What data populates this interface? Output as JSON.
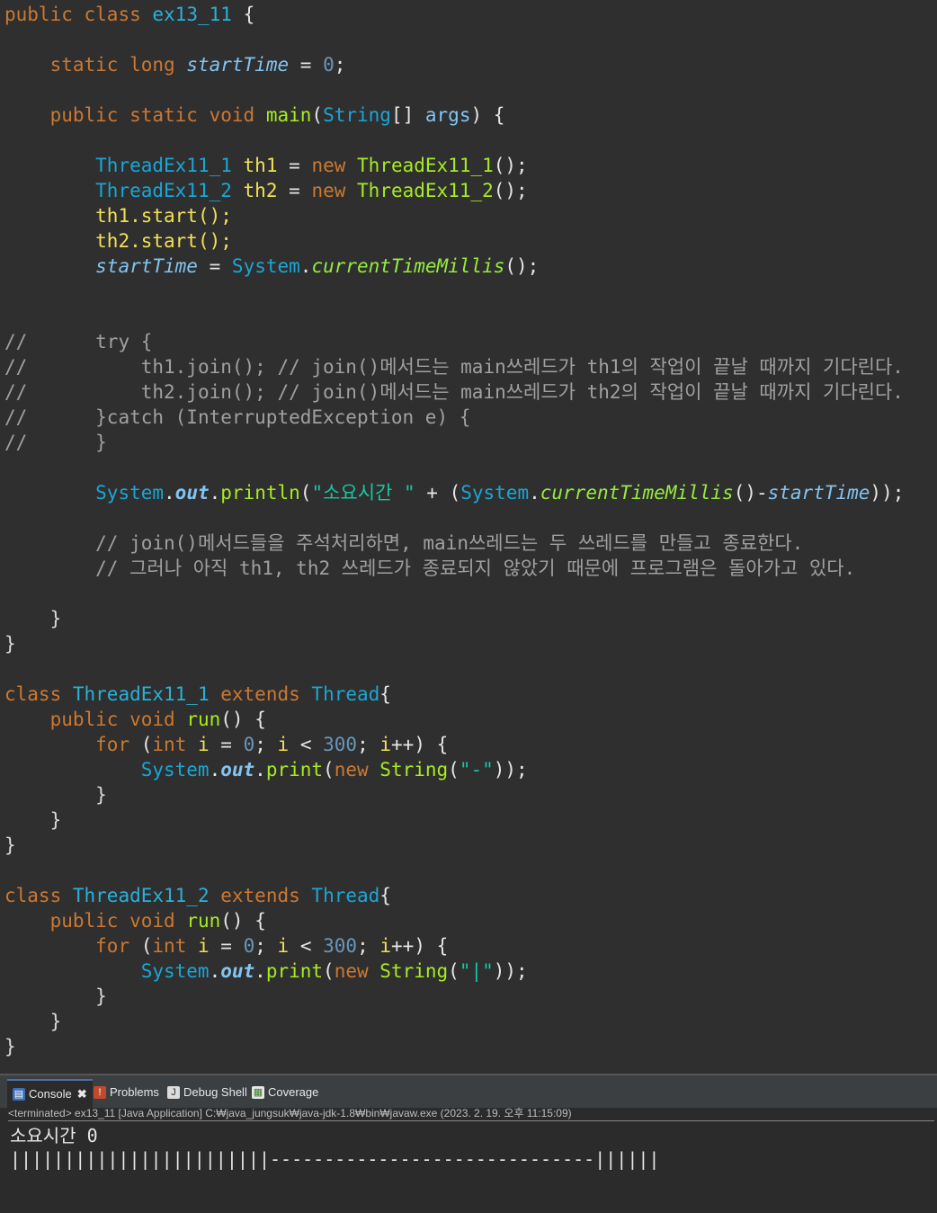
{
  "editor": {
    "class_decl": {
      "kw1": "public",
      "kw2": "class",
      "name": "ex13_11",
      "brace": "{"
    },
    "field": {
      "kw1": "static",
      "kw2": "long",
      "name": "startTime",
      "eq": "=",
      "val": "0",
      "end": ";"
    },
    "main_decl": {
      "kw1": "public",
      "kw2": "static",
      "kw3": "void",
      "name": "main",
      "p1": "(",
      "type": "String",
      "arr": "[]",
      "arg": "args",
      "p2": ") {"
    },
    "th1_decl": {
      "type": "ThreadEx11_1",
      "var": "th1",
      "eq": "=",
      "kw": "new",
      "ctor": "ThreadEx11_1",
      "end": "();"
    },
    "th2_decl": {
      "type": "ThreadEx11_2",
      "var": "th2",
      "eq": "=",
      "kw": "new",
      "ctor": "ThreadEx11_2",
      "end": "();"
    },
    "th1_start": "th1.start();",
    "th2_start": "th2.start();",
    "assign": {
      "var": "startTime",
      "eq": "=",
      "sys": "System",
      "dot": ".",
      "fn": "currentTimeMillis",
      "end": "();"
    },
    "commented": [
      {
        "slashes": "//",
        "code": "      try {"
      },
      {
        "slashes": "//",
        "code": "          th1.join(); // join()메서드는 main쓰레드가 th1의 작업이 끝날 때까지 기다린다."
      },
      {
        "slashes": "//",
        "code": "          th2.join(); // join()메서드는 main쓰레드가 th2의 작업이 끝날 때까지 기다린다."
      },
      {
        "slashes": "//",
        "code": "      }catch (InterruptedException e) {"
      },
      {
        "slashes": "//",
        "code": "      }"
      }
    ],
    "println": {
      "sys": "System",
      "dot1": ".",
      "out": "out",
      "dot2": ".",
      "fn": "println",
      "p1": "(",
      "str": "\"소요시간 \"",
      "plus": " + (",
      "sys2": "System",
      "dot3": ".",
      "fn2": "currentTimeMillis",
      "mid": "()-",
      "var": "startTime",
      "end": "));"
    },
    "comment1": "// join()메서드들을 주석처리하면, main쓰레드는 두 쓰레드를 만들고 종료한다.",
    "comment2": "// 그러나 아직 th1, th2 쓰레드가 종료되지 않았기 때문에 프로그램은 돌아가고 있다.",
    "close_brace": "}",
    "class1": {
      "kw": "class",
      "name": "ThreadEx11_1",
      "ext": "extends",
      "sup": "Thread",
      "brace": "{",
      "run": {
        "kw1": "public",
        "kw2": "void",
        "name": "run",
        "end": "() {"
      },
      "for": {
        "kw": "for",
        "p": "(",
        "t": "int",
        "i1": "i",
        "a": " = ",
        "n0": "0",
        "s1": "; ",
        "i2": "i",
        "lt": " < ",
        "n300": "300",
        "s2": "; ",
        "i3": "i",
        "inc": "++) {"
      },
      "print": {
        "sys": "System",
        "dot1": ".",
        "out": "out",
        "dot2": ".",
        "fn": "print",
        "p1": "(",
        "kw": "new",
        "ty": "String",
        "p2": "(",
        "str": "\"-\"",
        "end": "));"
      }
    },
    "class2": {
      "kw": "class",
      "name": "ThreadEx11_2",
      "ext": "extends",
      "sup": "Thread",
      "brace": "{",
      "run": {
        "kw1": "public",
        "kw2": "void",
        "name": "run",
        "end": "() {"
      },
      "for": {
        "kw": "for",
        "p": "(",
        "t": "int",
        "i1": "i",
        "a": " = ",
        "n0": "0",
        "s1": "; ",
        "i2": "i",
        "lt": " < ",
        "n300": "300",
        "s2": "; ",
        "i3": "i",
        "inc": "++) {"
      },
      "print": {
        "sys": "System",
        "dot1": ".",
        "out": "out",
        "dot2": ".",
        "fn": "print",
        "p1": "(",
        "kw": "new",
        "ty": "String",
        "p2": "(",
        "str": "\"|\"",
        "end": "));"
      }
    }
  },
  "console": {
    "tabs": [
      {
        "label": "Console",
        "icon": "console-icon"
      },
      {
        "label": "Problems",
        "icon": "problems-icon"
      },
      {
        "label": "Debug Shell",
        "icon": "debug-shell-icon"
      },
      {
        "label": "Coverage",
        "icon": "coverage-icon"
      }
    ],
    "close_glyph": "✖",
    "status": "<terminated> ex13_11 [Java Application] C:₩java_jungsuk₩java-jdk-1.8₩bin₩javaw.exe (2023. 2. 19. 오후 11:15:09)",
    "output_line1": "소요시간 0",
    "output_line2": "||||||||||||||||||||||||------------------------------||||||"
  }
}
